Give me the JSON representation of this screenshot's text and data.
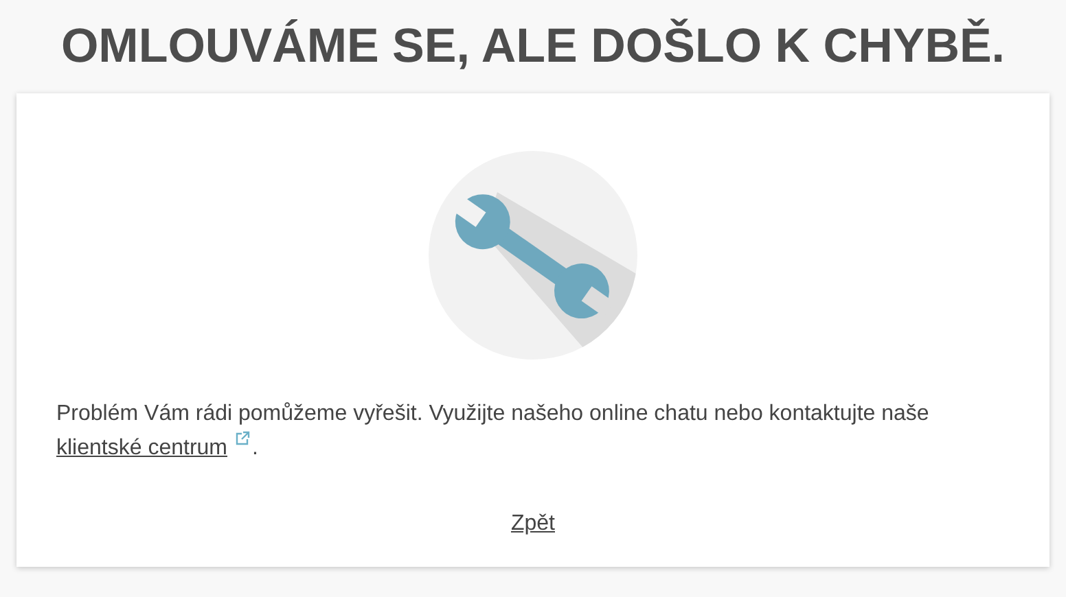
{
  "title": "OMLOUVÁME SE, ALE DOŠLO K CHYBĚ.",
  "message": {
    "text": "Problém Vám rádi pomůžeme vyřešit. Využijte našeho online chatu nebo kontaktujte naše ",
    "link": "klientské centrum",
    "after": "."
  },
  "back_link": "Zpět"
}
